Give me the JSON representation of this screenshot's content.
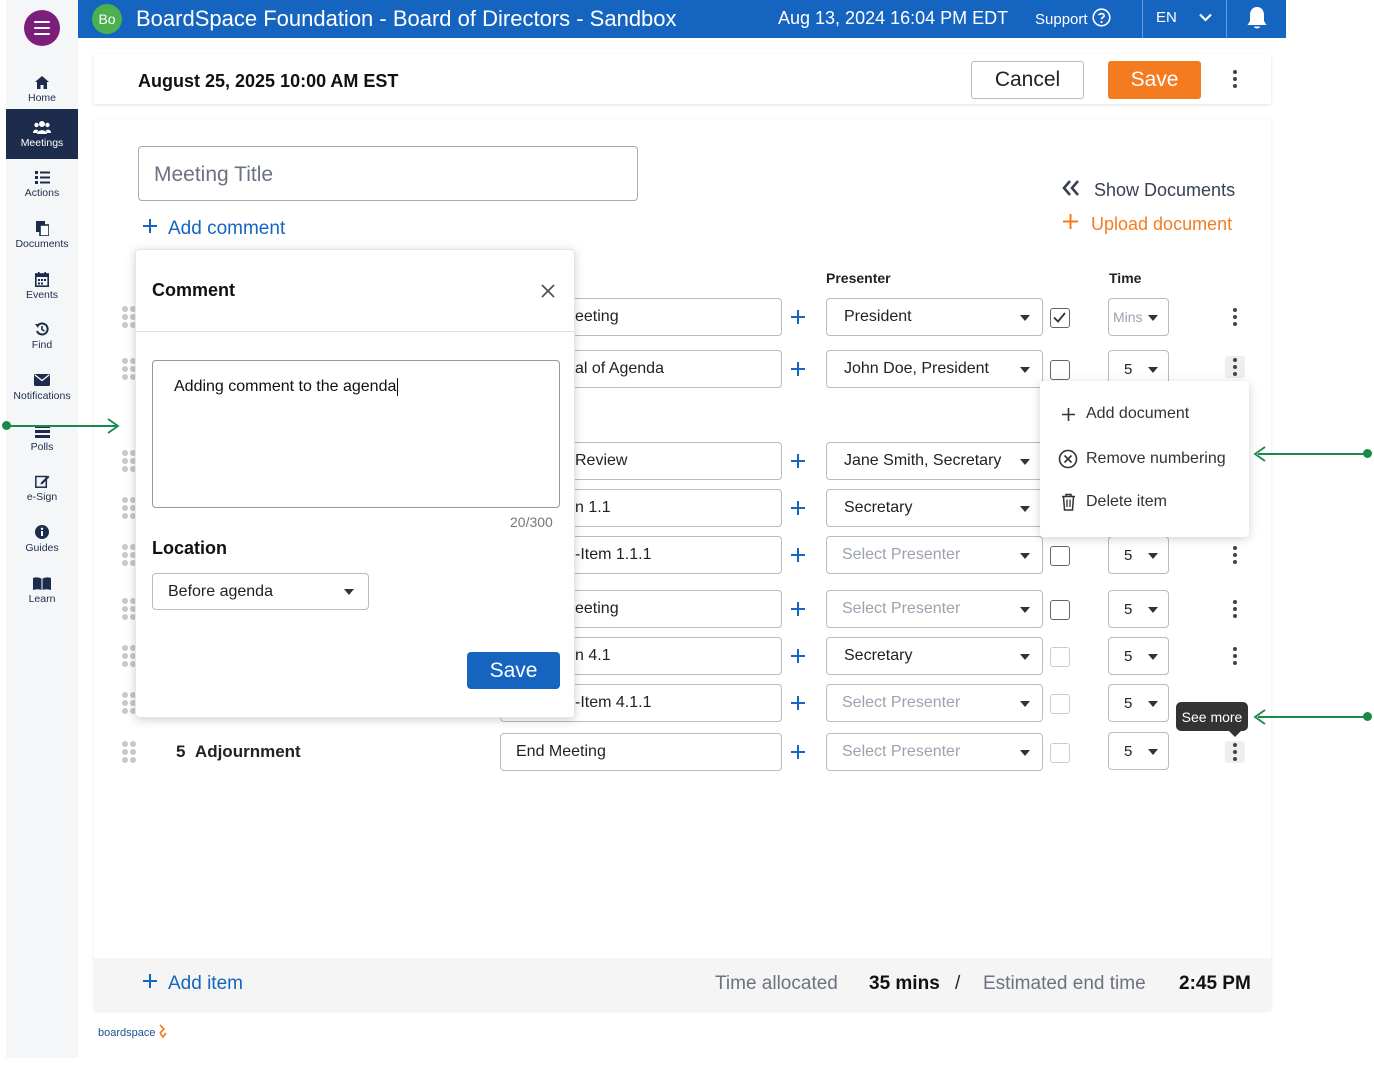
{
  "header": {
    "avatar_initials": "Bo",
    "title": "BoardSpace Foundation - Board of Directors - Sandbox",
    "datetime": "Aug 13, 2024 16:04 PM  EDT",
    "support_label": "Support",
    "language": "EN",
    "color": "#1565c0"
  },
  "sidebar": {
    "items": [
      {
        "label": "Home",
        "icon": "home-icon"
      },
      {
        "label": "Meetings",
        "icon": "people-icon",
        "active": true
      },
      {
        "label": "Actions",
        "icon": "list-icon"
      },
      {
        "label": "Documents",
        "icon": "documents-icon"
      },
      {
        "label": "Events",
        "icon": "calendar-icon"
      },
      {
        "label": "Find",
        "icon": "history-icon"
      },
      {
        "label": "Notifications",
        "icon": "envelope-icon"
      },
      {
        "label": "Polls",
        "icon": "polls-icon"
      },
      {
        "label": "e-Sign",
        "icon": "edit-icon"
      },
      {
        "label": "Guides",
        "icon": "info-icon"
      },
      {
        "label": "Learn",
        "icon": "book-icon"
      }
    ]
  },
  "toolbar": {
    "meeting_date": "August 25, 2025 10:00 AM EST",
    "cancel_label": "Cancel",
    "save_label": "Save",
    "save_color": "#f47b20"
  },
  "main": {
    "title_placeholder": "Meeting Title",
    "add_comment_label": "Add comment",
    "show_documents_label": "Show Documents",
    "upload_document_label": "Upload document",
    "columns": {
      "presenter": "Presenter",
      "time": "Time"
    },
    "rows": [
      {
        "item_text": "eeting",
        "presenter": "President",
        "presenter_placeholder": false,
        "checked": true,
        "check_disabled": false,
        "time": "Mins",
        "time_placeholder": true
      },
      {
        "item_text": "al of Agenda",
        "presenter": "John Doe, President",
        "presenter_placeholder": false,
        "checked": false,
        "check_disabled": false,
        "time": "5"
      },
      {
        "item_text": "Review",
        "presenter": "Jane Smith, Secretary",
        "presenter_placeholder": false
      },
      {
        "item_text": "n 1.1",
        "presenter": "Secretary",
        "presenter_placeholder": false
      },
      {
        "item_text": "-Item 1.1.1",
        "presenter": "Select Presenter",
        "presenter_placeholder": true,
        "checked": false,
        "check_disabled": false,
        "time": "5"
      },
      {
        "item_text": "eeting",
        "presenter": "Select Presenter",
        "presenter_placeholder": true,
        "checked": false,
        "check_disabled": false,
        "time": "5"
      },
      {
        "item_text": "n 4.1",
        "presenter": "Secretary",
        "presenter_placeholder": false,
        "checked": false,
        "check_disabled": true,
        "time": "5"
      },
      {
        "item_text": "-Item 4.1.1",
        "presenter": "Select Presenter",
        "presenter_placeholder": true,
        "checked": false,
        "check_disabled": true,
        "time": "5"
      },
      {
        "number": "5",
        "name": "Adjournment",
        "item_text": "End Meeting",
        "presenter": "Select Presenter",
        "presenter_placeholder": true,
        "checked": false,
        "check_disabled": true,
        "time": "5"
      }
    ]
  },
  "footer": {
    "add_item_label": "Add item",
    "time_allocated_label": "Time allocated",
    "time_allocated_value": "35 mins",
    "separator": "/",
    "end_time_label": "Estimated end time",
    "end_time_value": "2:45 PM"
  },
  "brand": "boardspace",
  "comment_popup": {
    "title": "Comment",
    "text": "Adding comment to the agenda",
    "counter": "20/300",
    "location_label": "Location",
    "location_value": "Before agenda",
    "save_label": "Save"
  },
  "context_menu": {
    "items": [
      {
        "label": "Add document",
        "icon": "plus-icon"
      },
      {
        "label": "Remove numbering",
        "icon": "circle-x-icon"
      },
      {
        "label": "Delete item",
        "icon": "trash-icon"
      }
    ]
  },
  "tooltip": "See more"
}
